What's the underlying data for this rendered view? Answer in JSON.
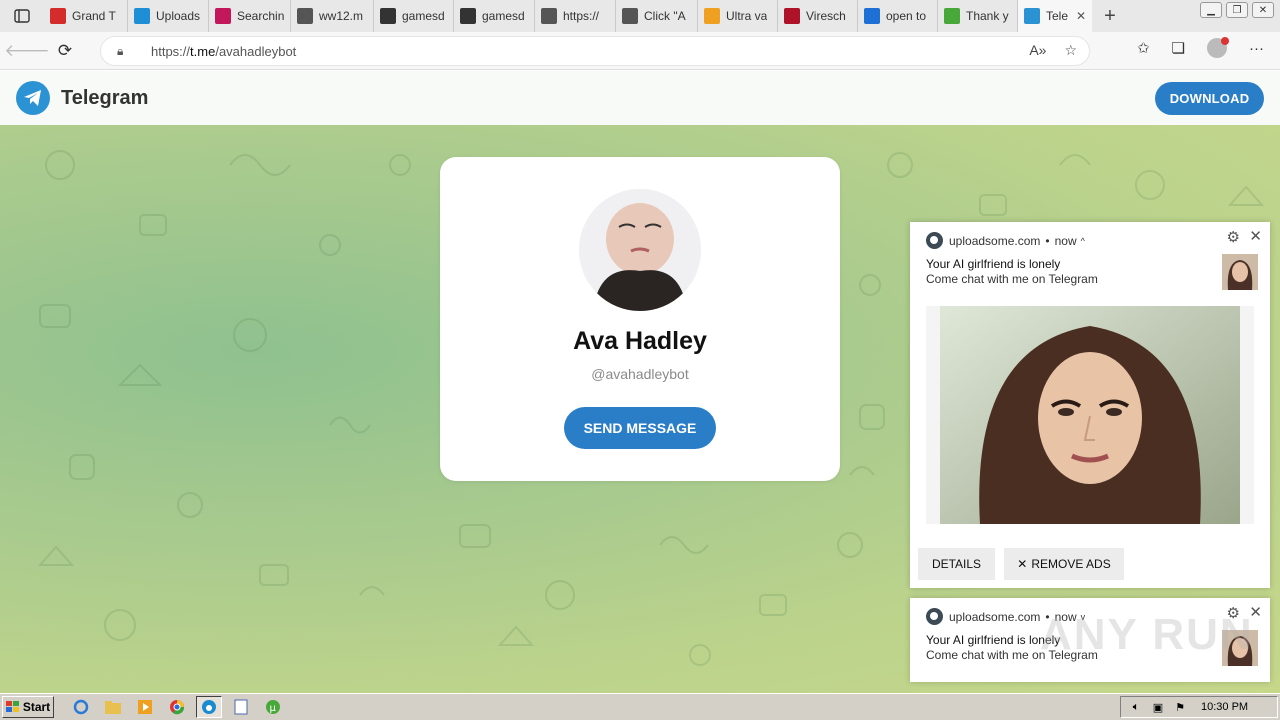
{
  "browser": {
    "tabs": [
      {
        "label": "Grand T",
        "icon": "gift-icon",
        "color": "#d42b2b"
      },
      {
        "label": "Uploads",
        "icon": "upload-icon",
        "color": "#1e8fd6"
      },
      {
        "label": "Searchin",
        "icon": "slack-icon",
        "color": "#c2185b"
      },
      {
        "label": "ww12.m",
        "icon": "page-icon",
        "color": "#555555"
      },
      {
        "label": "gamesd",
        "icon": "bag-icon",
        "color": "#333333"
      },
      {
        "label": "gamesd",
        "icon": "bag-icon",
        "color": "#333333"
      },
      {
        "label": "https://",
        "icon": "page-icon",
        "color": "#555555"
      },
      {
        "label": "Click \"A",
        "icon": "page-icon",
        "color": "#555555"
      },
      {
        "label": "Ultra va",
        "icon": "bolt-icon",
        "color": "#f0a020"
      },
      {
        "label": "Viresch",
        "icon": "shield-icon",
        "color": "#b0122a"
      },
      {
        "label": "open to",
        "icon": "search-icon",
        "color": "#1e6fd6"
      },
      {
        "label": "Thank y",
        "icon": "utorrent-icon",
        "color": "#49a83a"
      },
      {
        "label": "Tele",
        "icon": "telegram-icon",
        "color": "#2b92d4",
        "active": true
      }
    ],
    "address": {
      "protocol": "https://",
      "host": "t.me",
      "path": "/avahadleybot"
    }
  },
  "telegram": {
    "brand": "Telegram",
    "download_label": "DOWNLOAD",
    "accent": "#2a7ec8"
  },
  "profile": {
    "name": "Ava Hadley",
    "handle": "@avahadleybot",
    "send_label": "SEND MESSAGE"
  },
  "notifications": [
    {
      "site": "uploadsome.com",
      "time": "now",
      "expand": "^",
      "title": "Your AI girlfriend is lonely",
      "body": "Come chat with me on Telegram",
      "actions": [
        "DETAILS",
        "REMOVE ADS"
      ]
    },
    {
      "site": "uploadsome.com",
      "time": "now",
      "expand": "v",
      "title": "Your AI girlfriend is lonely",
      "body": "Come chat with me on Telegram"
    }
  ],
  "watermark": "ANY RUN",
  "taskbar": {
    "start_label": "Start",
    "clock": "10:30 PM"
  }
}
